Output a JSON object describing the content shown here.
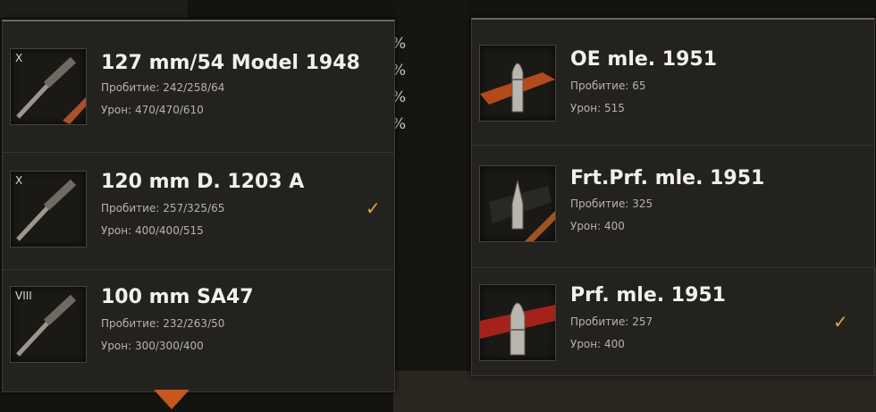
{
  "background": {
    "percents": [
      "%",
      "%",
      "%",
      "%"
    ]
  },
  "guns": [
    {
      "tier": "X",
      "name": "127 mm/54 Model 1948",
      "penetration": "Пробитие: 242/258/64",
      "damage": "Урон: 470/470/610",
      "selected": false,
      "stripe": "#a7522a"
    },
    {
      "tier": "X",
      "name": "120 mm D. 1203 A",
      "penetration": "Пробитие: 257/325/65",
      "damage": "Урон: 400/400/515",
      "selected": true,
      "stripe": ""
    },
    {
      "tier": "VIII",
      "name": "100 mm SA47",
      "penetration": "Пробитие: 232/263/50",
      "damage": "Урон: 300/300/400",
      "selected": false,
      "stripe": ""
    }
  ],
  "ammo": [
    {
      "name": "OE mle. 1951",
      "penetration": "Пробитие: 65",
      "damage": "Урон: 515",
      "selected": false,
      "stripe": "#b34a1c",
      "icon": "he-shell-icon"
    },
    {
      "name": "Frt.Prf. mle. 1951",
      "penetration": "Пробитие: 325",
      "damage": "Урон: 400",
      "selected": false,
      "stripe": "#9c5426",
      "icon": "heat-shell-icon"
    },
    {
      "name": "Prf. mle. 1951",
      "penetration": "Пробитие: 257",
      "damage": "Урон: 400",
      "selected": true,
      "stripe": "#a5211c",
      "icon": "ap-shell-icon"
    }
  ],
  "check_mark": "✓"
}
